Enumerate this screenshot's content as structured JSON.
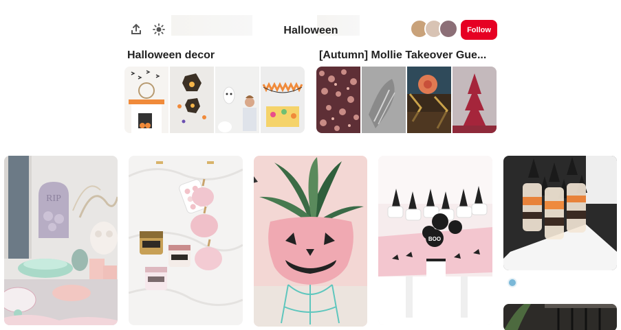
{
  "header": {
    "board_title": "Halloween",
    "follow_label": "Follow",
    "share_icon": "share-icon",
    "filter_icon": "sun-icon",
    "avatar_colors": [
      "#c9a27a",
      "#d8c3b4",
      "#8c6f77"
    ],
    "accent": "#e60023"
  },
  "boards": [
    {
      "title": "Halloween decor",
      "tiles": [
        "#f3f2f0",
        "#e7e6e4",
        "#f0f0f0",
        "#ececec"
      ]
    },
    {
      "title": "[Autumn] Mollie Takeover Gue...",
      "tiles": [
        "#6b3a3f",
        "#9a9a9a",
        "#3d2b1c",
        "#b86070"
      ]
    }
  ],
  "pins": [
    {
      "name": "pastel-halloween-tablescape",
      "text": "RIP"
    },
    {
      "name": "pink-pumpkins-paint"
    },
    {
      "name": "pumpkin-planter"
    },
    {
      "name": "pink-witch-party-table",
      "text": "BOO"
    },
    {
      "name": "witch-hat-parfaits"
    },
    {
      "name": "dark-pin-partial"
    }
  ]
}
